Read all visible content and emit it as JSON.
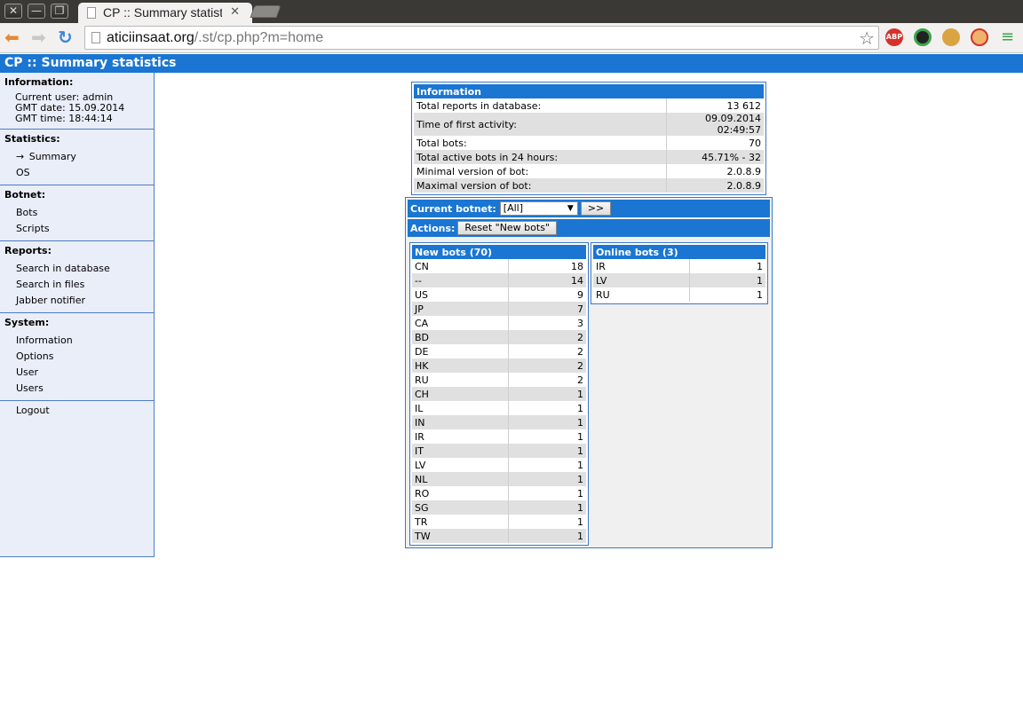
{
  "browser": {
    "tab_title": "CP :: Summary statisti",
    "url_host": "aticiinsaat.org",
    "url_rest": "/.st/cp.php?m=home",
    "extensions": [
      "ABP",
      "color-wheel",
      "cookie",
      "blocked"
    ]
  },
  "header": {
    "title": "CP :: Summary statistics"
  },
  "sidebar": {
    "information": {
      "title": "Information:",
      "current_user": "Current user: admin",
      "gmt_date": "GMT date:  15.09.2014",
      "gmt_time": "GMT time:  18:44:14"
    },
    "statistics": {
      "title": "Statistics:",
      "summary_arrow": "→",
      "summary": "Summary",
      "os": "OS"
    },
    "botnet": {
      "title": "Botnet:",
      "bots": "Bots",
      "scripts": "Scripts"
    },
    "reports": {
      "title": "Reports:",
      "search_db": "Search in database",
      "search_files": "Search in files",
      "jabber": "Jabber notifier"
    },
    "system": {
      "title": "System:",
      "information": "Information",
      "options": "Options",
      "user": "User",
      "users": "Users"
    },
    "logout": "Logout"
  },
  "info_box": {
    "title": "Information",
    "rows": [
      {
        "label": "Total reports in database:",
        "value": "13 612"
      },
      {
        "label": "Time of first activity:",
        "value": "09.09.2014 02:49:57"
      },
      {
        "label": "Total bots:",
        "value": "70"
      },
      {
        "label": "Total active bots in 24 hours:",
        "value": "45.71% - 32"
      },
      {
        "label": "Minimal version of bot:",
        "value": "2.0.8.9"
      },
      {
        "label": "Maximal version of bot:",
        "value": "2.0.8.9"
      }
    ]
  },
  "botnet_box": {
    "current_botnet_label": "Current botnet:",
    "current_botnet_value": "[All]",
    "go_button": ">>",
    "actions_label": "Actions:",
    "reset_button": "Reset \"New bots\"",
    "new_bots": {
      "title": "New bots (70)",
      "rows": [
        [
          "CN",
          "18"
        ],
        [
          "--",
          "14"
        ],
        [
          "US",
          "9"
        ],
        [
          "JP",
          "7"
        ],
        [
          "CA",
          "3"
        ],
        [
          "BD",
          "2"
        ],
        [
          "DE",
          "2"
        ],
        [
          "HK",
          "2"
        ],
        [
          "RU",
          "2"
        ],
        [
          "CH",
          "1"
        ],
        [
          "IL",
          "1"
        ],
        [
          "IN",
          "1"
        ],
        [
          "IR",
          "1"
        ],
        [
          "IT",
          "1"
        ],
        [
          "LV",
          "1"
        ],
        [
          "NL",
          "1"
        ],
        [
          "RO",
          "1"
        ],
        [
          "SG",
          "1"
        ],
        [
          "TR",
          "1"
        ],
        [
          "TW",
          "1"
        ]
      ]
    },
    "online_bots": {
      "title": "Online bots (3)",
      "rows": [
        [
          "IR",
          "1"
        ],
        [
          "LV",
          "1"
        ],
        [
          "RU",
          "1"
        ]
      ]
    }
  }
}
